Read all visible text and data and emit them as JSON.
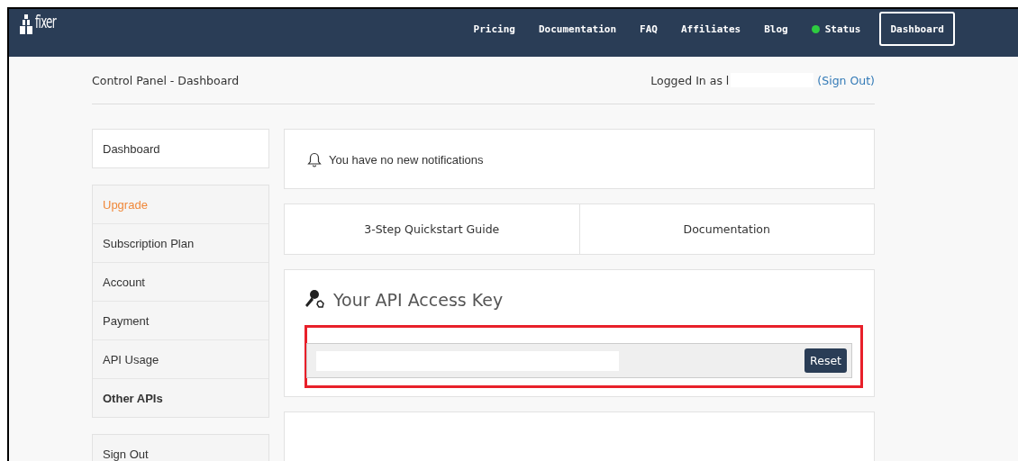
{
  "navbar": {
    "logo": "fixer",
    "links": [
      {
        "label": "Pricing",
        "kind": "link"
      },
      {
        "label": "Documentation",
        "kind": "link"
      },
      {
        "label": "FAQ",
        "kind": "link"
      },
      {
        "label": "Affiliates",
        "kind": "link"
      },
      {
        "label": "Blog",
        "kind": "link"
      },
      {
        "label": "Status",
        "kind": "status",
        "color": "#2ecc40"
      },
      {
        "label": "Dashboard",
        "kind": "button"
      }
    ]
  },
  "header": {
    "breadcrumb": "Control Panel - Dashboard",
    "logged_in": "Logged In as l",
    "sign_out": "(Sign Out)"
  },
  "sidebar": {
    "groups": [
      [
        {
          "label": "Dashboard",
          "kind": "plain"
        }
      ],
      [
        {
          "label": "Upgrade",
          "kind": "accent"
        },
        {
          "label": "Subscription Plan",
          "kind": "plain"
        },
        {
          "label": "Account",
          "kind": "plain"
        },
        {
          "label": "Payment",
          "kind": "plain"
        },
        {
          "label": "API Usage",
          "kind": "plain"
        },
        {
          "label": "Other APIs",
          "kind": "bold"
        }
      ],
      [
        {
          "label": "Sign Out",
          "kind": "plain"
        }
      ]
    ]
  },
  "notifications": {
    "text": "You have no new notifications"
  },
  "quick_links": [
    "3-Step Quickstart Guide",
    "Documentation"
  ],
  "api_key": {
    "title": "Your API Access Key",
    "reset_button": "Reset",
    "highlighted": true
  }
}
